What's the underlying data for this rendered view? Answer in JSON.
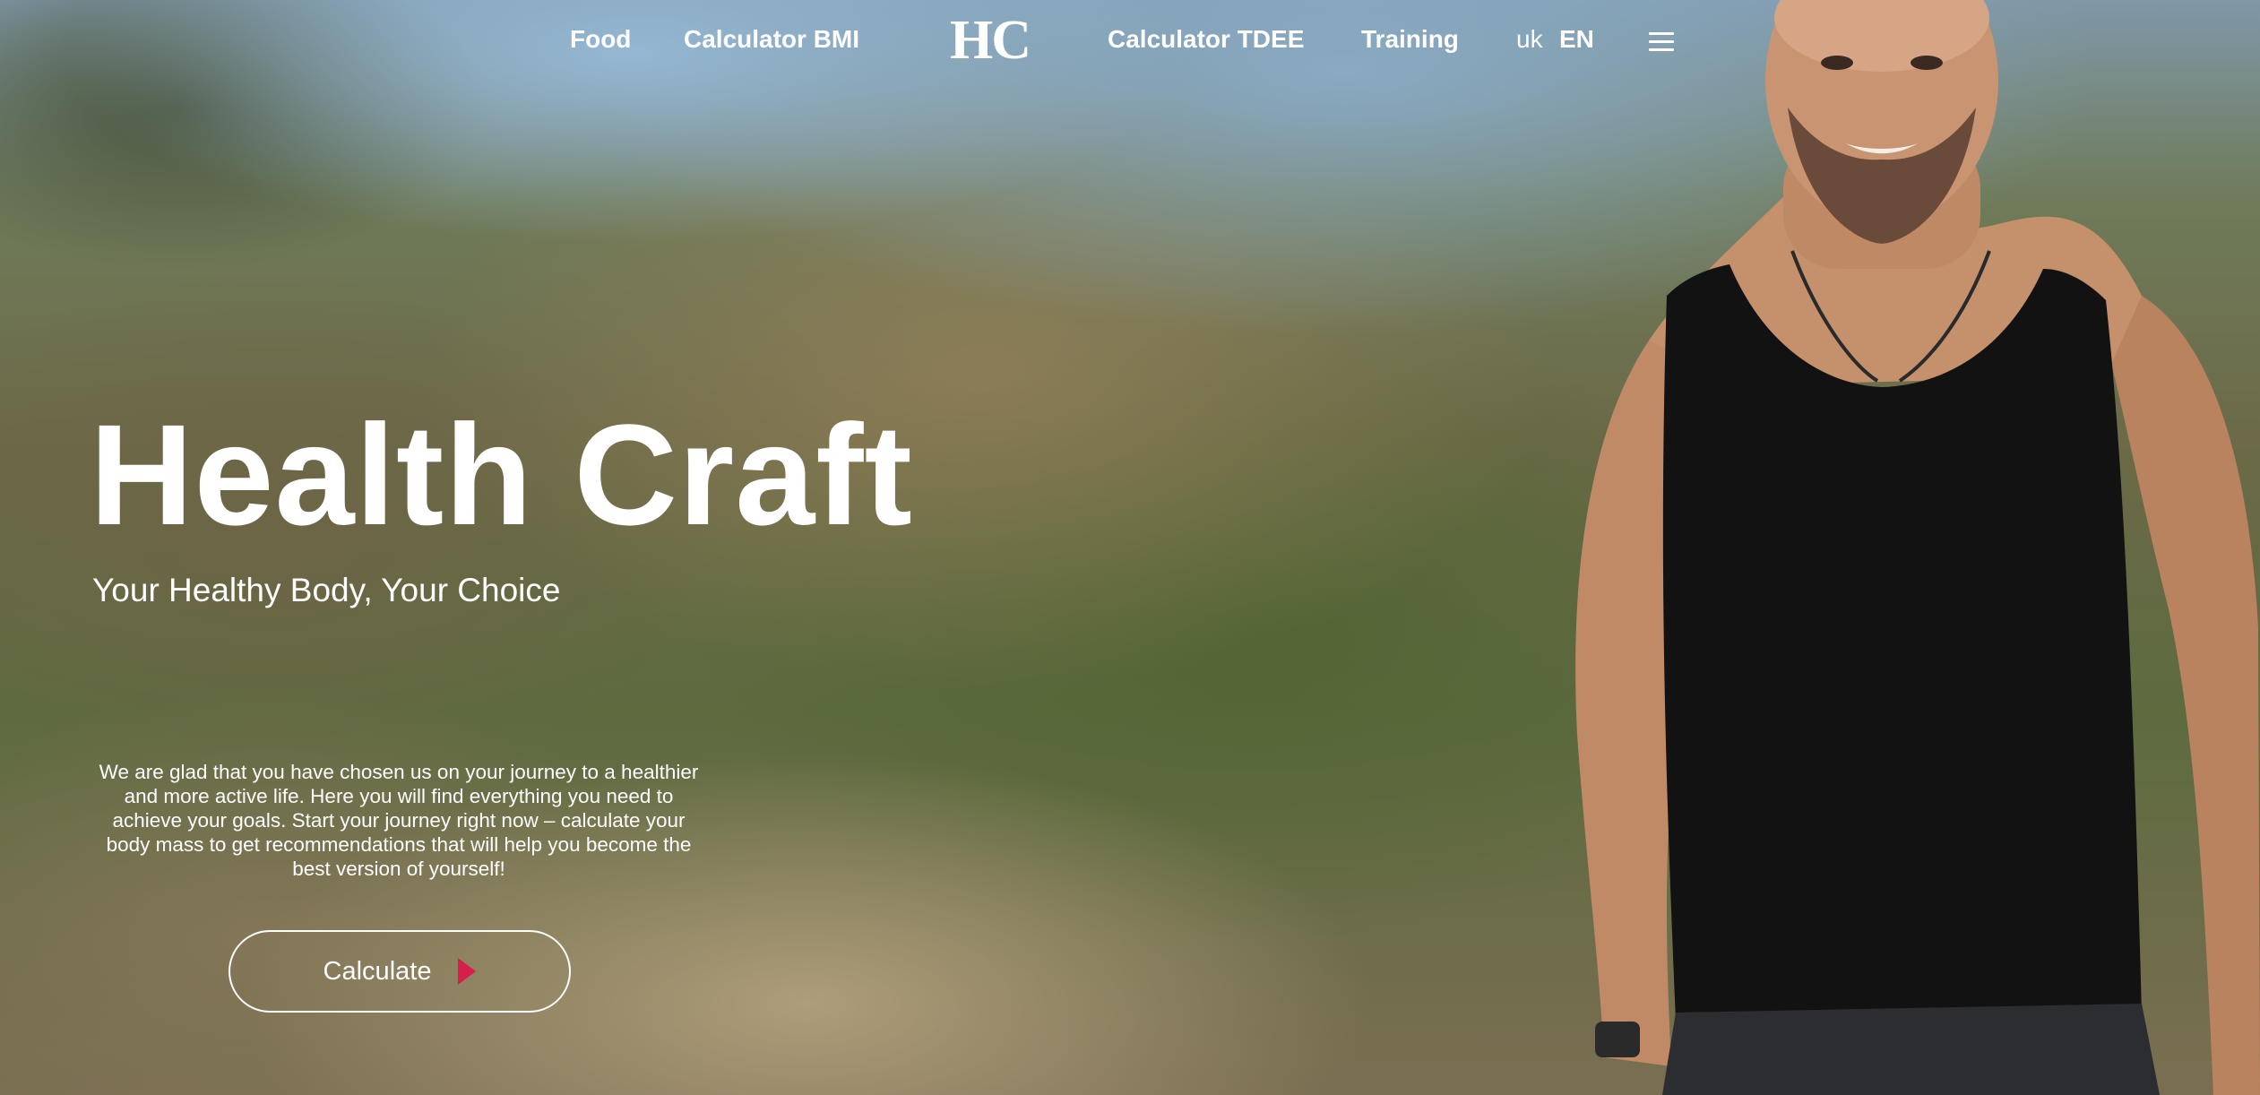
{
  "nav": {
    "items": [
      {
        "label": "Food"
      },
      {
        "label": "Calculator BMI"
      },
      {
        "label": "Calculator TDEE"
      },
      {
        "label": "Training"
      }
    ],
    "logo": "HC",
    "lang_uk": "uk",
    "lang_en": "EN",
    "menu_icon": "hamburger-menu-icon"
  },
  "hero": {
    "title": "Health Craft",
    "subtitle": "Your Healthy Body, Your Choice",
    "text": "We are glad that you have chosen us on your journey to a healthier and more active life. Here you will find everything you need to achieve your goals. Start your journey right now – calculate your body mass to get recommendations that will help you become the best version of yourself!",
    "cta_label": "Calculate",
    "cta_icon": "play-arrow-icon"
  },
  "colors": {
    "accent": "#d81e4a",
    "text": "#ffffff"
  }
}
